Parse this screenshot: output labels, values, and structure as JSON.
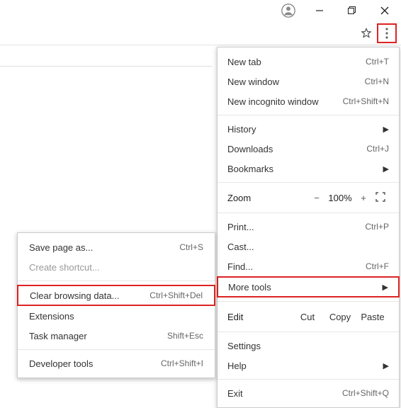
{
  "menu": {
    "newTab": {
      "label": "New tab",
      "shortcut": "Ctrl+T"
    },
    "newWindow": {
      "label": "New window",
      "shortcut": "Ctrl+N"
    },
    "newIncognito": {
      "label": "New incognito window",
      "shortcut": "Ctrl+Shift+N"
    },
    "history": {
      "label": "History"
    },
    "downloads": {
      "label": "Downloads",
      "shortcut": "Ctrl+J"
    },
    "bookmarks": {
      "label": "Bookmarks"
    },
    "zoom": {
      "label": "Zoom",
      "minus": "−",
      "percent": "100%",
      "plus": "+"
    },
    "print": {
      "label": "Print...",
      "shortcut": "Ctrl+P"
    },
    "cast": {
      "label": "Cast..."
    },
    "find": {
      "label": "Find...",
      "shortcut": "Ctrl+F"
    },
    "moreTools": {
      "label": "More tools"
    },
    "edit": {
      "label": "Edit",
      "cut": "Cut",
      "copy": "Copy",
      "paste": "Paste"
    },
    "settings": {
      "label": "Settings"
    },
    "help": {
      "label": "Help"
    },
    "exit": {
      "label": "Exit",
      "shortcut": "Ctrl+Shift+Q"
    }
  },
  "submenu": {
    "saveAs": {
      "label": "Save page as...",
      "shortcut": "Ctrl+S"
    },
    "createShortcut": {
      "label": "Create shortcut..."
    },
    "clearBrowsing": {
      "label": "Clear browsing data...",
      "shortcut": "Ctrl+Shift+Del"
    },
    "extensions": {
      "label": "Extensions"
    },
    "taskManager": {
      "label": "Task manager",
      "shortcut": "Shift+Esc"
    },
    "devTools": {
      "label": "Developer tools",
      "shortcut": "Ctrl+Shift+I"
    }
  },
  "highlight_color": "#d22"
}
